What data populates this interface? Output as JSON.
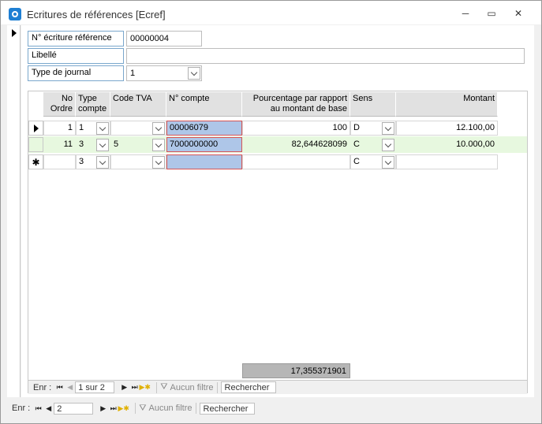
{
  "window": {
    "title": "Ecritures de références [Ecref]",
    "controls": {
      "minimize": "─",
      "restore": "▭",
      "close": "✕"
    }
  },
  "form": {
    "fields": {
      "ecriture_label": "N° écriture référence",
      "ecriture_value": "00000004",
      "libelle_label": "Libellé",
      "libelle_value": "",
      "journal_label": "Type de journal",
      "journal_value": "1"
    }
  },
  "subform": {
    "headers": {
      "no_ordre": "No Ordre",
      "type_compte": "Type compte",
      "code_tva": "Code TVA",
      "n_compte": "N° compte",
      "pourcentage": "Pourcentage par rapport au montant de base",
      "sens": "Sens",
      "montant": "Montant"
    },
    "rows": [
      {
        "no_ordre": "1",
        "type_compte": "1",
        "code_tva": "",
        "n_compte": "00006079",
        "pourcentage": "100",
        "sens": "D",
        "montant": "12.100,00"
      },
      {
        "no_ordre": "11",
        "type_compte": "3",
        "code_tva": "5",
        "n_compte": "7000000000",
        "pourcentage": "82,644628099",
        "sens": "C",
        "montant": "10.000,00"
      },
      {
        "no_ordre": "",
        "type_compte": "3",
        "code_tva": "",
        "n_compte": "",
        "pourcentage": "",
        "sens": "C",
        "montant": ""
      }
    ],
    "new_row_symbol": "✱",
    "total": "17,355371901",
    "nav": {
      "record_label": "Enr :",
      "record_value": "1 sur 2",
      "filter_label": "Aucun filtre",
      "search_label": "Rechercher"
    }
  },
  "main_nav": {
    "record_label": "Enr :",
    "record_value": "2",
    "filter_label": "Aucun filtre",
    "search_label": "Rechercher"
  }
}
